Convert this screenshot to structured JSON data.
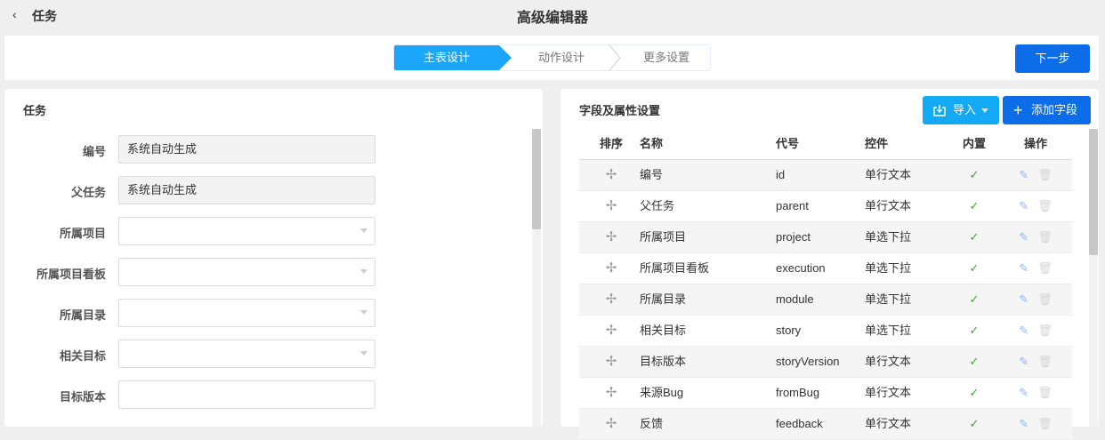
{
  "header": {
    "back_icon": "‹",
    "back_label": "任务",
    "title": "高级编辑器"
  },
  "steps": [
    {
      "label": "主表设计",
      "active": true
    },
    {
      "label": "动作设计"
    },
    {
      "label": "更多设置"
    }
  ],
  "next_label": "下一步",
  "left": {
    "title": "任务",
    "fields": [
      {
        "label": "编号",
        "value": "系统自动生成",
        "type": "readonly"
      },
      {
        "label": "父任务",
        "value": "系统自动生成",
        "type": "readonly"
      },
      {
        "label": "所属项目",
        "value": "",
        "type": "select"
      },
      {
        "label": "所属项目看板",
        "value": "",
        "type": "select"
      },
      {
        "label": "所属目录",
        "value": "",
        "type": "select"
      },
      {
        "label": "相关目标",
        "value": "",
        "type": "select"
      },
      {
        "label": "目标版本",
        "value": "",
        "type": "text"
      }
    ]
  },
  "right": {
    "title": "字段及属性设置",
    "import_label": "导入",
    "add_label": "添加字段",
    "columns": [
      "排序",
      "名称",
      "代号",
      "控件",
      "内置",
      "操作"
    ],
    "rows": [
      {
        "name": "编号",
        "code": "id",
        "control": "单行文本",
        "builtin": true
      },
      {
        "name": "父任务",
        "code": "parent",
        "control": "单行文本",
        "builtin": true
      },
      {
        "name": "所属项目",
        "code": "project",
        "control": "单选下拉",
        "builtin": true
      },
      {
        "name": "所属项目看板",
        "code": "execution",
        "control": "单选下拉",
        "builtin": true
      },
      {
        "name": "所属目录",
        "code": "module",
        "control": "单选下拉",
        "builtin": true
      },
      {
        "name": "相关目标",
        "code": "story",
        "control": "单选下拉",
        "builtin": true
      },
      {
        "name": "目标版本",
        "code": "storyVersion",
        "control": "单行文本",
        "builtin": true
      },
      {
        "name": "来源Bug",
        "code": "fromBug",
        "control": "单行文本",
        "builtin": true
      },
      {
        "name": "反馈",
        "code": "feedback",
        "control": "单行文本",
        "builtin": true
      }
    ]
  },
  "colors": {
    "primary": "#0d6ce8",
    "step_active": "#1ba5fb",
    "import": "#14a9f5"
  }
}
